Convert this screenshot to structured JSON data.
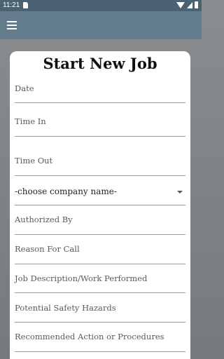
{
  "status_bar": {
    "time": "11:21"
  },
  "form": {
    "title": "Start New Job",
    "date_label": "Date",
    "time_in_label": "Time In",
    "time_out_label": "Time Out",
    "company_select_value": "-choose company name-",
    "authorized_by_label": "Authorized By",
    "reason_label": "Reason For Call",
    "job_description_label": "Job Description/Work Performed",
    "safety_hazards_label": "Potential Safety Hazards",
    "recommended_action_label": "Recommended Action or Procedures"
  }
}
